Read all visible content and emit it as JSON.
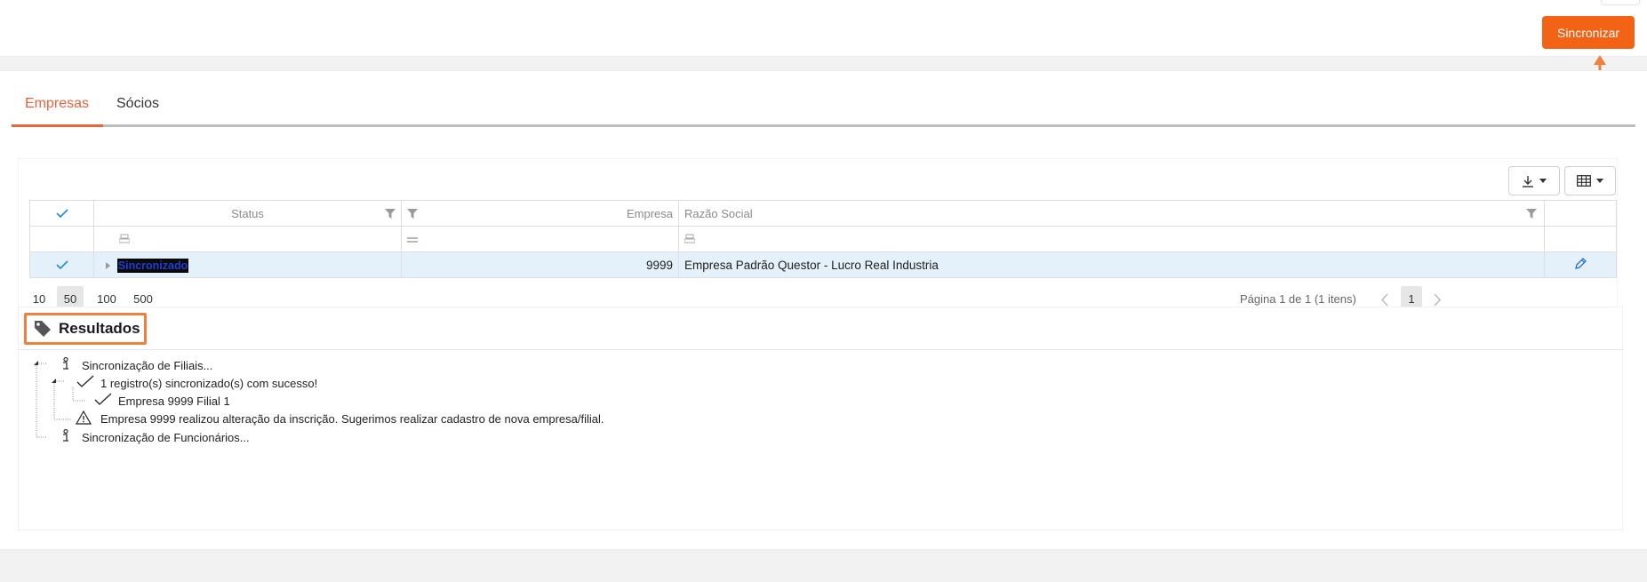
{
  "header": {
    "sync_button": "Sincronizar"
  },
  "tabs": [
    {
      "label": "Empresas",
      "active": true
    },
    {
      "label": "Sócios",
      "active": false
    }
  ],
  "toolbar": {
    "download_icon": "download-icon",
    "columns_icon": "table-icon"
  },
  "grid": {
    "columns": [
      "Status",
      "Empresa",
      "Razão Social"
    ],
    "rows": [
      {
        "status": "Sincronizado",
        "empresa": "9999",
        "razao_social": "Empresa Padrão Questor - Lucro Real Industria",
        "selected": true
      }
    ]
  },
  "pager": {
    "sizes": [
      "10",
      "50",
      "100",
      "500"
    ],
    "active_size": "50",
    "info": "Página 1 de 1 (1 itens)",
    "current_page": "1"
  },
  "results": {
    "title": "Resultados",
    "tree": [
      "Sincronização de Filiais...",
      "1 registro(s) sincronizado(s) com sucesso!",
      "Empresa 9999 Filial 1",
      "Empresa 9999 realizou alteração da inscrição. Sugerimos realizar cadastro de nova empresa/filial.",
      "Sincronização de Funcionários..."
    ]
  },
  "colors": {
    "accent": "#f26316",
    "tab_active": "#e8643a",
    "selected_row": "#e4f1fb",
    "highlight_box": "#f0803c"
  }
}
